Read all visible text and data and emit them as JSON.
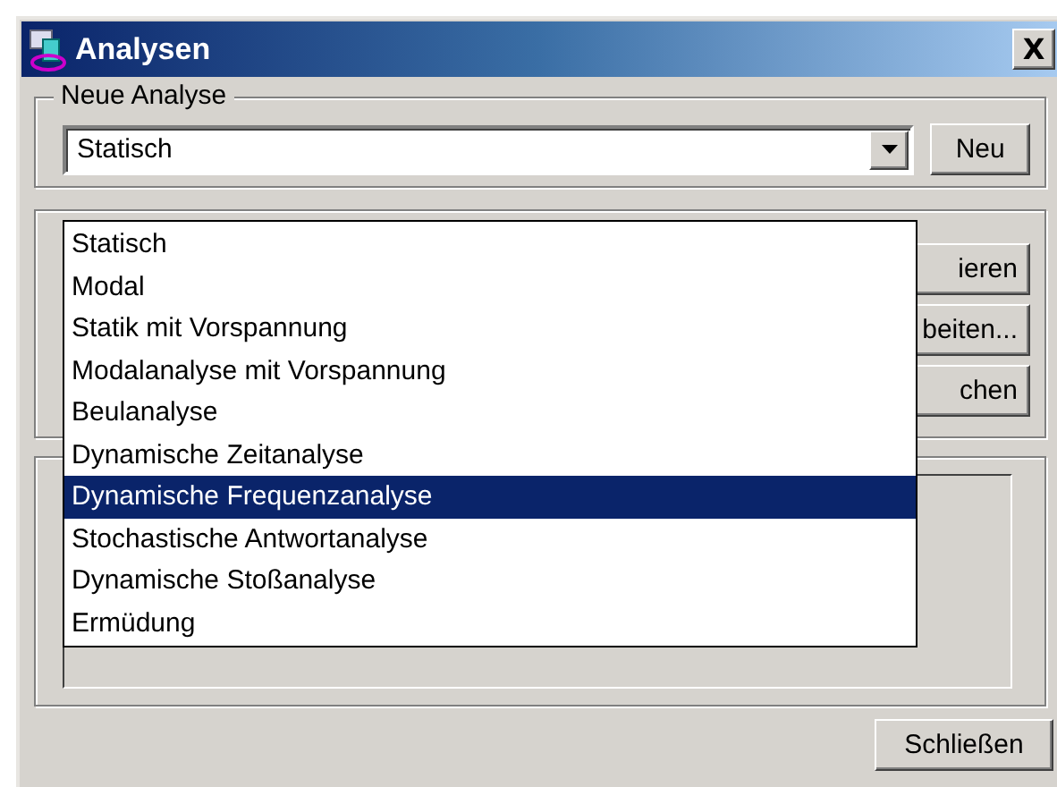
{
  "window": {
    "title": "Analysen",
    "close": "X"
  },
  "new_analysis": {
    "legend": "Neue Analyse",
    "combo_value": "Statisch",
    "new_button": "Neu"
  },
  "side_buttons": [
    "ieren",
    "beiten...",
    "chen"
  ],
  "dropdown": [
    {
      "label": "Statisch",
      "selected": false
    },
    {
      "label": "Modal",
      "selected": false
    },
    {
      "label": "Statik mit Vorspannung",
      "selected": false
    },
    {
      "label": "Modalanalyse mit Vorspannung",
      "selected": false
    },
    {
      "label": "Beulanalyse",
      "selected": false
    },
    {
      "label": "Dynamische Zeitanalyse",
      "selected": false
    },
    {
      "label": "Dynamische Frequenzanalyse",
      "selected": true
    },
    {
      "label": "Stochastische Antwortanalyse",
      "selected": false
    },
    {
      "label": "Dynamische Stoßanalyse",
      "selected": false
    },
    {
      "label": "Ermüdung",
      "selected": false
    }
  ],
  "close_button": "Schließen"
}
